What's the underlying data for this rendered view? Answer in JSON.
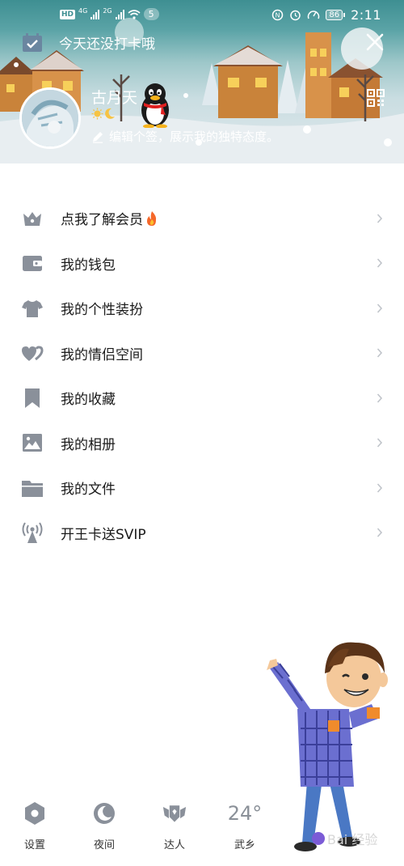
{
  "status_bar": {
    "hd_label": "HD",
    "sim1_label": "4G",
    "sim2_label": "2G",
    "badge_count": "5",
    "battery_level": "86",
    "time": "2:11"
  },
  "header": {
    "checkin_text": "今天还没打卡哦",
    "nickname": "古月天",
    "signature": "编辑个签，展示我的独特态度。"
  },
  "menu": [
    {
      "label": "点我了解会员",
      "icon": "vip-crown-icon"
    },
    {
      "label": "我的钱包",
      "icon": "wallet-icon"
    },
    {
      "label": "我的个性装扮",
      "icon": "tshirt-icon"
    },
    {
      "label": "我的情侣空间",
      "icon": "hearts-icon"
    },
    {
      "label": "我的收藏",
      "icon": "bookmark-icon"
    },
    {
      "label": "我的相册",
      "icon": "photo-icon"
    },
    {
      "label": "我的文件",
      "icon": "folder-icon"
    },
    {
      "label": "开王卡送SVIP",
      "icon": "signal-tower-icon"
    }
  ],
  "bottom_bar": {
    "settings_label": "设置",
    "night_label": "夜间",
    "expert_label": "达人",
    "weather_temp": "24°",
    "weather_label": "武乡"
  },
  "watermark_text": "Bai 经验",
  "colors": {
    "icon_gray": "#8a909a",
    "header_teal": "#3e8f92",
    "fire": "#f5682a"
  }
}
